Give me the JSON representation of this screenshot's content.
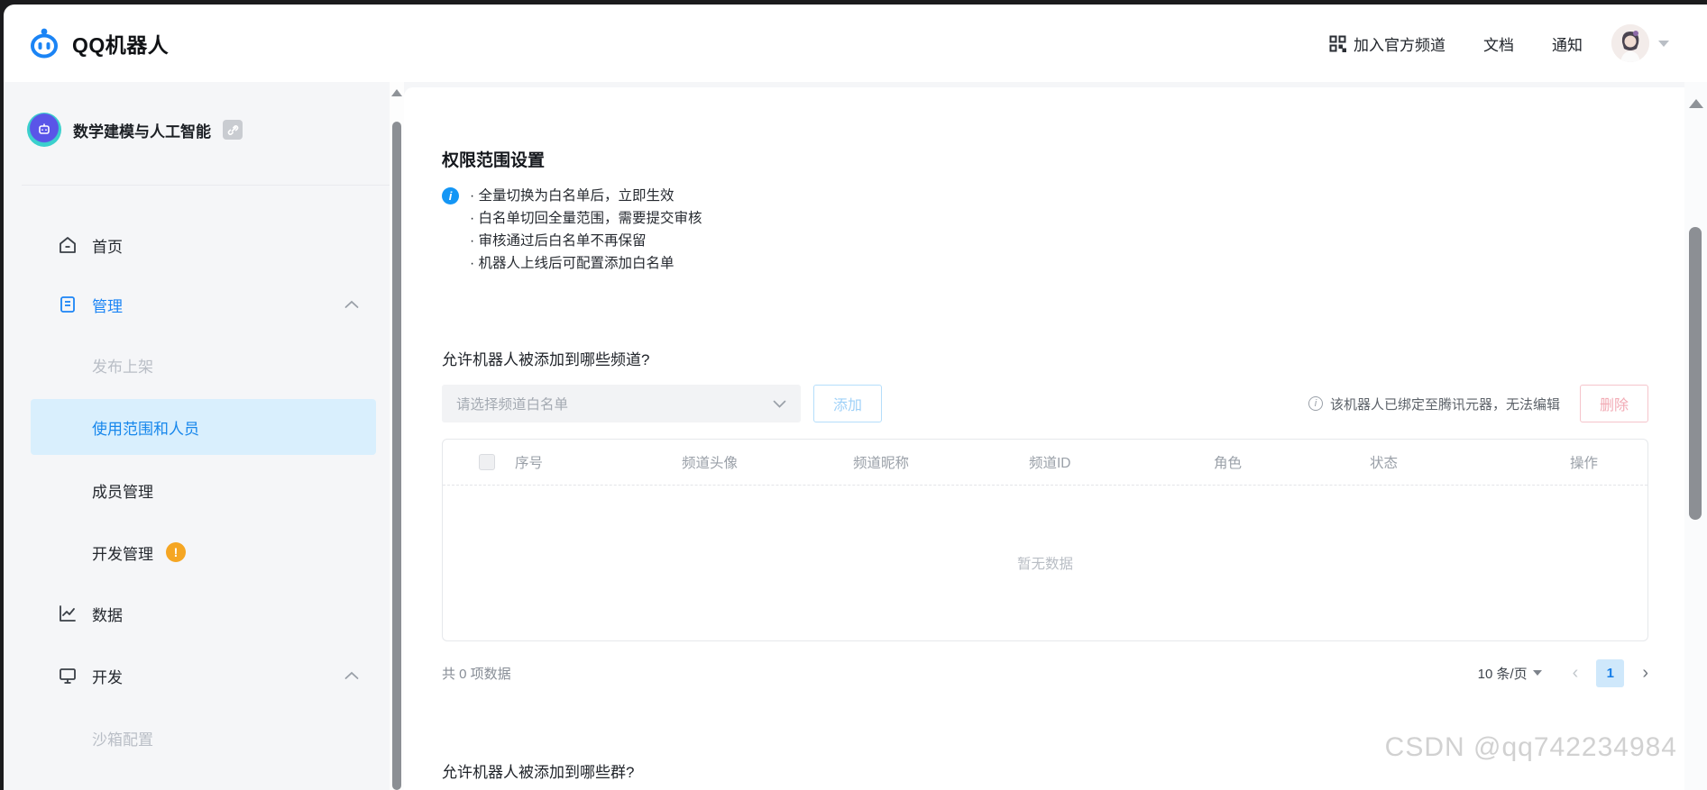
{
  "header": {
    "logo_text": "QQ机器人",
    "nav": {
      "join_channel": "加入官方频道",
      "docs": "文档",
      "notifications": "通知"
    }
  },
  "sidebar": {
    "bot": {
      "name": "数学建模与人工智能"
    },
    "items": [
      {
        "label": "首页",
        "icon": "home-icon",
        "state": "normal",
        "level": 1
      },
      {
        "label": "管理",
        "icon": "document-icon",
        "state": "expanded",
        "level": 1
      },
      {
        "label": "发布上架",
        "state": "disabled",
        "level": 2
      },
      {
        "label": "使用范围和人员",
        "state": "active",
        "level": 2
      },
      {
        "label": "成员管理",
        "state": "normal",
        "level": 2
      },
      {
        "label": "开发管理",
        "state": "normal",
        "level": 2,
        "badge": "!"
      },
      {
        "label": "数据",
        "icon": "chart-icon",
        "state": "normal",
        "level": 1
      },
      {
        "label": "开发",
        "icon": "monitor-icon",
        "state": "expanded",
        "level": 1
      },
      {
        "label": "沙箱配置",
        "state": "disabled",
        "level": 2
      }
    ]
  },
  "main": {
    "title": "权限范围设置",
    "notice": {
      "lines": [
        "· 全量切换为白名单后，立即生效",
        "· 白名单切回全量范围，需要提交审核",
        "· 审核通过后白名单不再保留",
        "· 机器人上线后可配置添加白名单"
      ]
    },
    "channel_section": {
      "question": "允许机器人被添加到哪些频道?",
      "select_placeholder": "请选择频道白名单",
      "add_button": "添加",
      "locked_note": "该机器人已绑定至腾讯元器，无法编辑",
      "delete_button": "删除",
      "table": {
        "columns": [
          "序号",
          "频道头像",
          "频道昵称",
          "频道ID",
          "角色",
          "状态",
          "操作"
        ],
        "empty_text": "暂无数据"
      },
      "pagination": {
        "total_text": "共 0 项数据",
        "page_size": "10 条/页",
        "prev": "‹",
        "current_page": "1",
        "next": "›"
      }
    },
    "group_section": {
      "question": "允许机器人被添加到哪些群?"
    }
  },
  "watermark": "CSDN @qq742234984",
  "colors": {
    "accent_blue": "#1b84f5",
    "active_item_bg": "#d9effd",
    "warning_orange": "#f5a623",
    "disabled_blue_button": "#9fd1f8",
    "disabled_red_button": "#f2aab4",
    "pagination_current_bg": "#cfe8fb",
    "sidebar_bg": "#f5f6f8",
    "scrollbar_thumb": "#8c8f94"
  }
}
